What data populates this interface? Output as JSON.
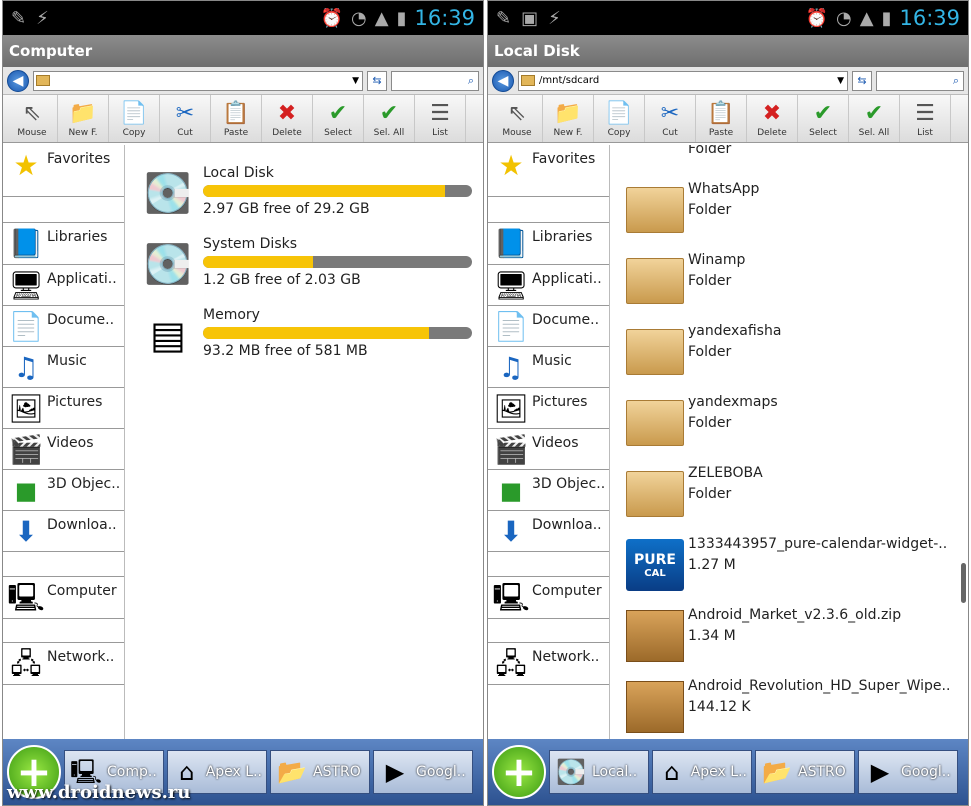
{
  "status_bar": {
    "time": "16:39"
  },
  "toolbar_items": [
    {
      "label": "Mouse",
      "icon": "mouse-pointer-icon",
      "glyph": "⇖"
    },
    {
      "label": "New F.",
      "icon": "new-folder-icon",
      "glyph": "📁"
    },
    {
      "label": "Copy",
      "icon": "copy-icon",
      "glyph": "📄"
    },
    {
      "label": "Cut",
      "icon": "scissors-icon",
      "glyph": "✂"
    },
    {
      "label": "Paste",
      "icon": "clipboard-icon",
      "glyph": "📋"
    },
    {
      "label": "Delete",
      "icon": "delete-x-icon",
      "glyph": "✖"
    },
    {
      "label": "Select",
      "icon": "checkmark-icon",
      "glyph": "✔"
    },
    {
      "label": "Sel. All",
      "icon": "select-all-icon",
      "glyph": "✔"
    },
    {
      "label": "List",
      "icon": "list-view-icon",
      "glyph": "☰"
    }
  ],
  "sidebar": {
    "favorites": "Favorites",
    "libraries": "Libraries",
    "applications": "Applicati..",
    "documents": "Docume..",
    "music": "Music",
    "pictures": "Pictures",
    "videos": "Videos",
    "objects3d": "3D Objec..",
    "downloads": "Downloa..",
    "computer": "Computer",
    "network": "Network.."
  },
  "left": {
    "title": "Computer",
    "path": "",
    "drives": [
      {
        "name": "Local Disk",
        "free": "2.97 GB free of 29.2 GB",
        "used_fraction": 0.9
      },
      {
        "name": "System Disks",
        "free": "1.2 GB free of 2.03 GB",
        "used_fraction": 0.41
      },
      {
        "name": "Memory",
        "free": "93.2 MB free of 581 MB",
        "used_fraction": 0.84
      }
    ],
    "tasks": [
      {
        "label": "Comp..",
        "icon": "computer-icon"
      },
      {
        "label": "Apex L..",
        "icon": "home-icon"
      },
      {
        "label": "ASTRO",
        "icon": "astro-folder-icon"
      },
      {
        "label": "Googl..",
        "icon": "google-play-icon"
      }
    ],
    "watermark": "www.droidnews.ru"
  },
  "right": {
    "title": "Local Disk",
    "path": "/mnt/sdcard",
    "partial_top": "Folder",
    "files": [
      {
        "name": "WhatsApp",
        "sub": "Folder",
        "kind": "folder"
      },
      {
        "name": "Winamp",
        "sub": "Folder",
        "kind": "folder"
      },
      {
        "name": "yandexafisha",
        "sub": "Folder",
        "kind": "folder"
      },
      {
        "name": "yandexmaps",
        "sub": "Folder",
        "kind": "folder"
      },
      {
        "name": "ZELEBOBA",
        "sub": "Folder",
        "kind": "folder"
      },
      {
        "name": "1333443957_pure-calendar-widget-..",
        "sub": "1.27 M",
        "kind": "app"
      },
      {
        "name": "Android_Market_v2.3.6_old.zip",
        "sub": "1.34 M",
        "kind": "archive"
      },
      {
        "name": "Android_Revolution_HD_Super_Wipe..",
        "sub": "144.12 K",
        "kind": "archive"
      }
    ],
    "app_icon_text": {
      "line1": "PURE",
      "line2": "CAL"
    },
    "tasks": [
      {
        "label": "Local..",
        "icon": "hard-disk-icon"
      },
      {
        "label": "Apex L..",
        "icon": "home-icon"
      },
      {
        "label": "ASTRO",
        "icon": "astro-folder-icon"
      },
      {
        "label": "Googl..",
        "icon": "google-play-icon"
      }
    ]
  }
}
